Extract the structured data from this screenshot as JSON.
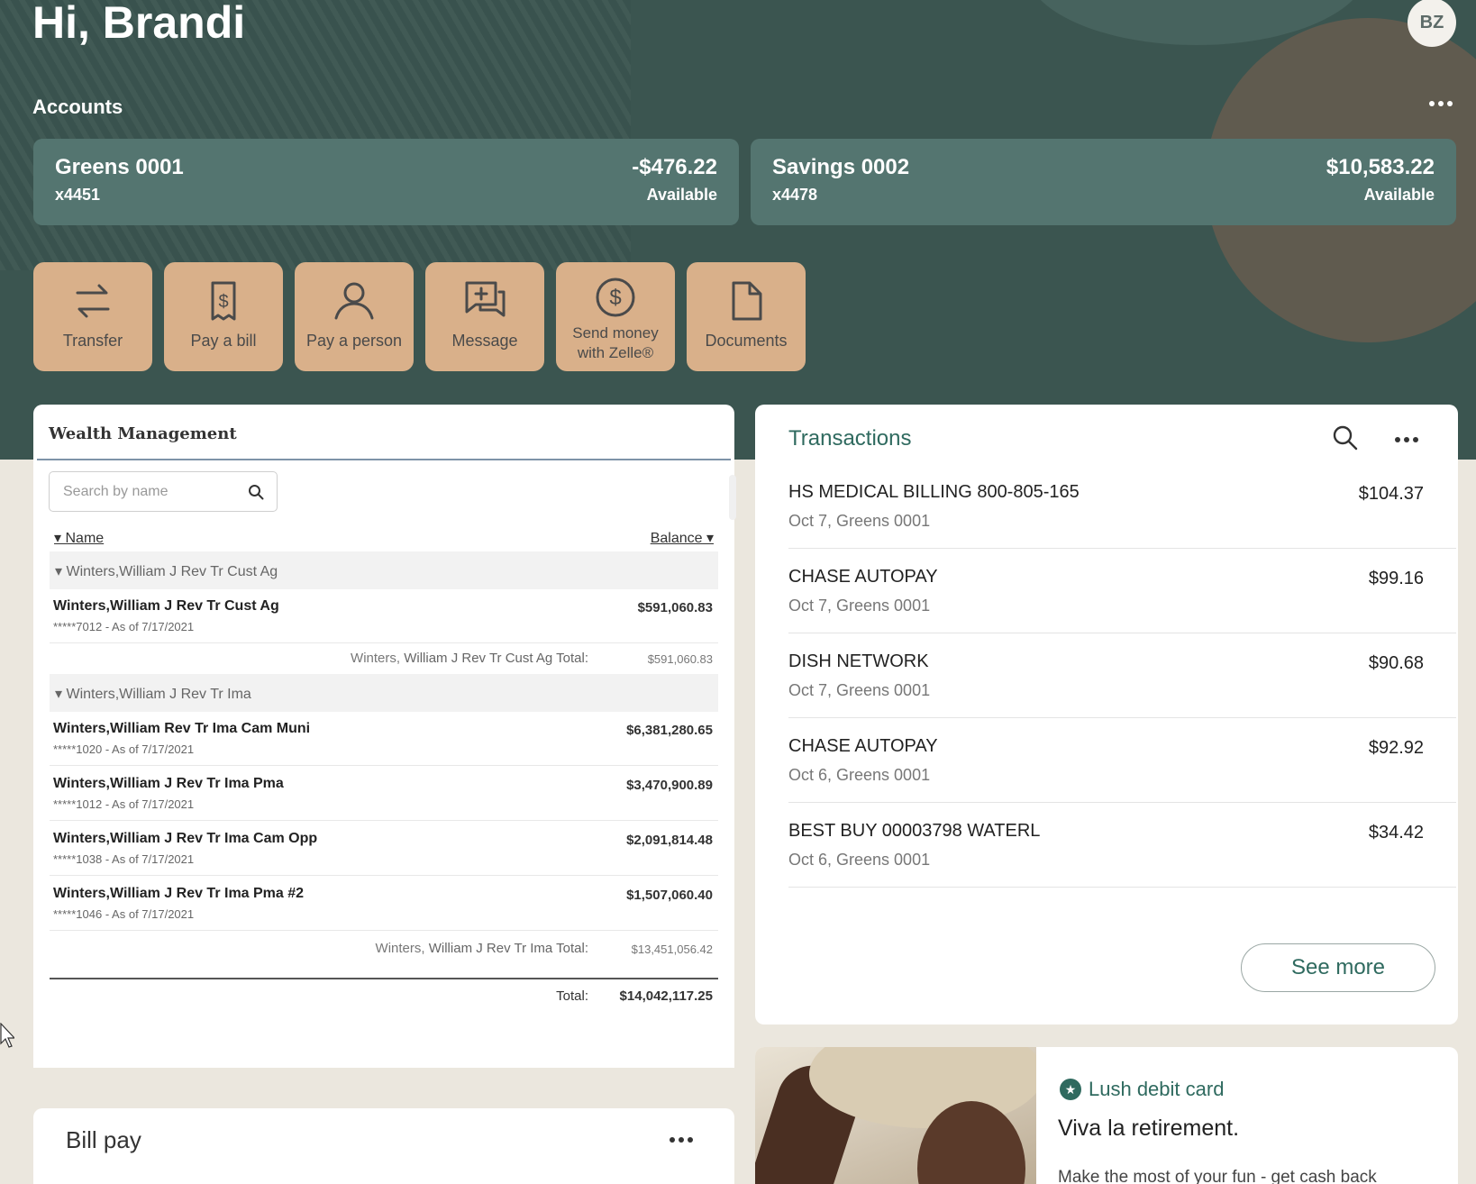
{
  "header": {
    "greeting": "Hi, Brandi",
    "avatar_initials": "BZ"
  },
  "accounts": {
    "title": "Accounts",
    "items": [
      {
        "name": "Greens 0001",
        "number": "x4451",
        "balance": "-$476.22",
        "balance_label": "Available"
      },
      {
        "name": "Savings 0002",
        "number": "x4478",
        "balance": "$10,583.22",
        "balance_label": "Available"
      }
    ]
  },
  "quick_actions": [
    {
      "label": "Transfer",
      "icon": "transfer-icon"
    },
    {
      "label": "Pay a bill",
      "icon": "bill-icon"
    },
    {
      "label": "Pay a person",
      "icon": "person-icon"
    },
    {
      "label": "Message",
      "icon": "message-icon"
    },
    {
      "label": "Send money",
      "label2": "with Zelle®",
      "icon": "zelle-dollar-icon"
    },
    {
      "label": "Documents",
      "icon": "document-icon"
    }
  ],
  "wealth": {
    "title": "Wealth Management",
    "search_placeholder": "Search by name",
    "col_name": "Name",
    "col_balance": "Balance",
    "groups": [
      {
        "name": "Winters,William J Rev Tr Cust Ag",
        "rows": [
          {
            "name": "Winters,William J Rev Tr Cust Ag",
            "sub": "*****7012 - As of 7/17/2021",
            "value": "$591,060.83"
          }
        ],
        "total_prefix": "Winters,",
        "total_label": "William J Rev Tr Cust Ag Total:",
        "total_value": "$591,060.83"
      },
      {
        "name": "Winters,William J Rev Tr Ima",
        "rows": [
          {
            "name": "Winters,William Rev Tr Ima Cam Muni",
            "sub": "*****1020 - As of 7/17/2021",
            "value": "$6,381,280.65"
          },
          {
            "name": "Winters,William J Rev Tr Ima Pma",
            "sub": "*****1012 - As of 7/17/2021",
            "value": "$3,470,900.89"
          },
          {
            "name": "Winters,William J Rev Tr Ima Cam Opp",
            "sub": "*****1038 - As of 7/17/2021",
            "value": "$2,091,814.48"
          },
          {
            "name": "Winters,William J Rev Tr Ima Pma #2",
            "sub": "*****1046 - As of 7/17/2021",
            "value": "$1,507,060.40"
          }
        ],
        "total_prefix": "Winters,",
        "total_label": "William J Rev Tr Ima Total:",
        "total_value": "$13,451,056.42"
      }
    ],
    "grand_total_label": "Total:",
    "grand_total_value": "$14,042,117.25"
  },
  "billpay": {
    "title": "Bill pay"
  },
  "transactions": {
    "title": "Transactions",
    "items": [
      {
        "merchant": "HS MEDICAL BILLING 800-805-165",
        "detail": "Oct 7, Greens 0001",
        "amount": "$104.37"
      },
      {
        "merchant": "CHASE AUTOPAY",
        "detail": "Oct 7, Greens 0001",
        "amount": "$99.16"
      },
      {
        "merchant": "DISH NETWORK",
        "detail": "Oct 7, Greens 0001",
        "amount": "$90.68"
      },
      {
        "merchant": "CHASE AUTOPAY",
        "detail": "Oct 6, Greens 0001",
        "amount": "$92.92"
      },
      {
        "merchant": "BEST BUY 00003798 WATERL",
        "detail": "Oct 6, Greens 0001",
        "amount": "$34.42"
      }
    ],
    "see_more": "See more"
  },
  "promo": {
    "badge": "Lush debit card",
    "headline": "Viva la retirement.",
    "body": "Make the most of your fun - get cash back"
  },
  "colors": {
    "hero_bg": "#3b5550",
    "account_card": "#547570",
    "action_tile": "#d9b08a",
    "accent": "#2f6a5f",
    "page_bg": "#ebe7de"
  }
}
